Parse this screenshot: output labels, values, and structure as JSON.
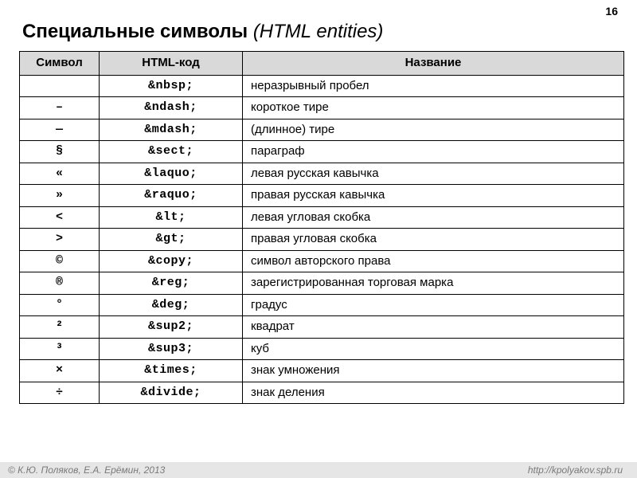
{
  "page_number": "16",
  "title_bold": "Специальные символы",
  "title_italic": "(HTML entities)",
  "columns": [
    "Символ",
    "HTML-код",
    "Название"
  ],
  "rows": [
    {
      "sym": " ",
      "code": "&nbsp;",
      "desc": "неразрывный пробел"
    },
    {
      "sym": "–",
      "code": "&ndash;",
      "desc": "короткое тире"
    },
    {
      "sym": "—",
      "code": "&mdash;",
      "desc": "(длинное) тире"
    },
    {
      "sym": "§",
      "code": "&sect;",
      "desc": "параграф"
    },
    {
      "sym": "«",
      "code": "&laquo;",
      "desc": "левая русская кавычка"
    },
    {
      "sym": "»",
      "code": "&raquo;",
      "desc": "правая русская кавычка"
    },
    {
      "sym": "<",
      "code": "&lt;",
      "desc": "левая угловая скобка"
    },
    {
      "sym": ">",
      "code": "&gt;",
      "desc": "правая угловая скобка"
    },
    {
      "sym": "©",
      "code": "&copy;",
      "desc": "символ авторского права"
    },
    {
      "sym": "®",
      "code": "&reg;",
      "desc": "зарегистрированная торговая марка"
    },
    {
      "sym": "°",
      "code": "&deg;",
      "desc": "градус"
    },
    {
      "sym": "²",
      "code": "&sup2;",
      "desc": "квадрат"
    },
    {
      "sym": "³",
      "code": "&sup3;",
      "desc": "куб"
    },
    {
      "sym": "×",
      "code": "&times;",
      "desc": "знак умножения"
    },
    {
      "sym": "÷",
      "code": "&divide;",
      "desc": "знак деления"
    }
  ],
  "footer_left": "© К.Ю. Поляков, Е.А. Ерёмин, 2013",
  "footer_right": "http://kpolyakov.spb.ru"
}
